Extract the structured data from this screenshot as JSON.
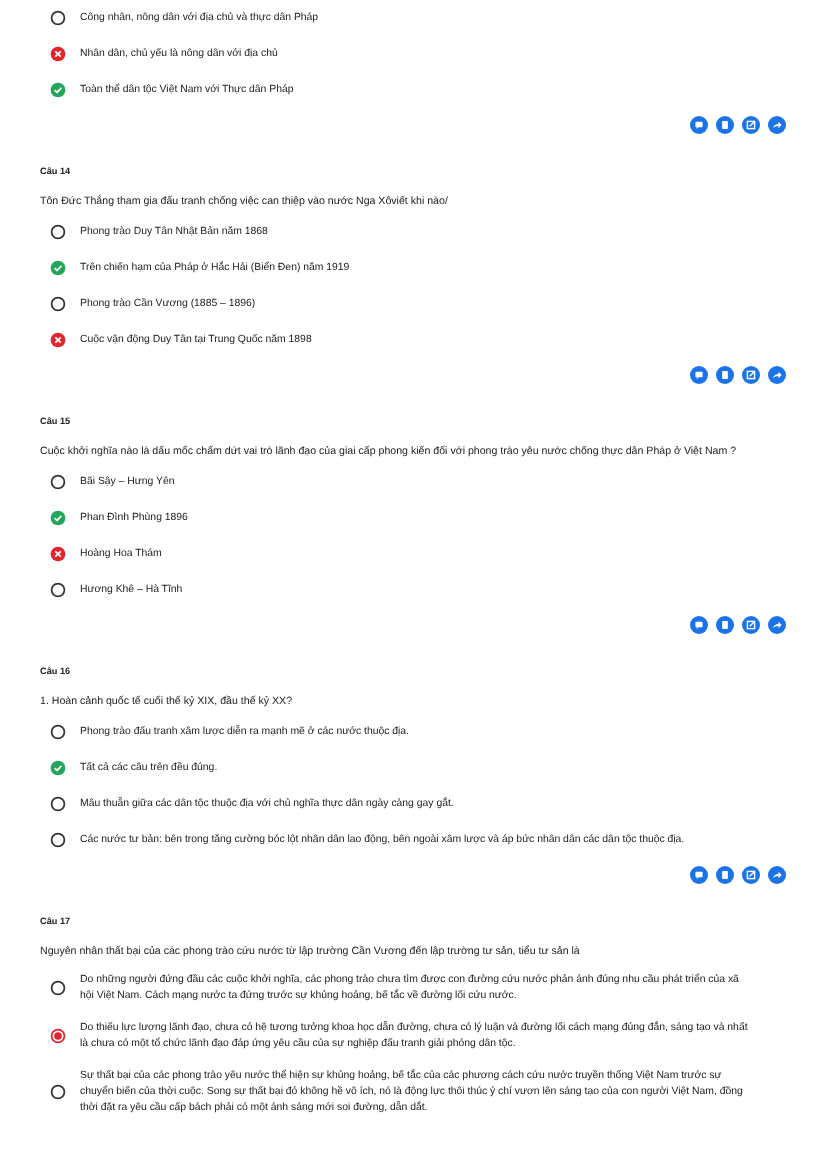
{
  "questions": [
    {
      "actions": true,
      "options": [
        {
          "text": "Công nhân, nông dân với địa chủ và thực dân Pháp",
          "kind": "empty"
        },
        {
          "text": "Nhân dân, chủ yếu là nông dân với địa chủ",
          "kind": "wrong"
        },
        {
          "text": "Toàn thể dân tộc Việt Nam với Thực dân Pháp",
          "kind": "correct"
        }
      ]
    },
    {
      "actions": true,
      "label": "Câu 14",
      "question": "Tôn Đức Thắng tham gia đấu tranh chống việc can thiệp vào nước Nga Xôviết khi nào/",
      "options": [
        {
          "text": "Phong trào Duy Tân Nhật Bản năm 1868",
          "kind": "empty"
        },
        {
          "text": "Trên chiến hạm của Pháp ở Hắc Hải (Biển Đen) năm 1919",
          "kind": "correct"
        },
        {
          "text": "Phong trào Cần Vương (1885 – 1896)",
          "kind": "empty"
        },
        {
          "text": "Cuộc vận động Duy Tân tại Trung Quốc năm 1898",
          "kind": "wrong"
        }
      ]
    },
    {
      "actions": true,
      "label": "Câu 15",
      "question": "Cuộc khởi nghĩa nào là dấu mốc chấm dứt vai trò lãnh đạo của giai cấp phong kiến đối với phong trào yêu nước chống thực dân Pháp ở Việt Nam ?",
      "options": [
        {
          "text": "Bãi Sậy – Hưng Yên",
          "kind": "empty"
        },
        {
          "text": "Phan Đình Phùng 1896",
          "kind": "correct"
        },
        {
          "text": "Hoàng Hoa Thám",
          "kind": "wrong"
        },
        {
          "text": "Hương Khê – Hà Tĩnh",
          "kind": "empty"
        }
      ]
    },
    {
      "actions": true,
      "label": "Câu 16",
      "question": "1. Hoàn cảnh quốc tế cuối thế kỷ XIX, đầu thế kỷ XX?",
      "options": [
        {
          "text": "Phong trào đấu tranh xâm lược diễn ra mạnh mẽ ở các nước thuộc địa.",
          "kind": "empty"
        },
        {
          "text": "Tất cả các câu trên đều đúng.",
          "kind": "correct"
        },
        {
          "text": "Mâu thuẫn giữa các dân tộc thuộc địa với chủ nghĩa thực dân ngày càng gay gắt.",
          "kind": "empty"
        },
        {
          "text": "Các nước tư bản: bên trong tăng cường bóc lột nhân dân lao động, bên ngoài xâm lược và áp bức nhân dân các dân tộc thuộc địa.",
          "kind": "empty"
        }
      ]
    },
    {
      "label": "Câu 17",
      "question": "Nguyên nhân thất bại của các phong trào cứu nước từ lập trường Cần Vương đến lập trường tư sản, tiểu tư sản là",
      "options": [
        {
          "text": "Do những người đứng đầu các cuộc khởi nghĩa, các phong trào chưa tìm được con đường cứu nước phản ánh đúng nhu cầu phát triển của xã hội Việt Nam. Cách mạng nước ta đứng trước sự khủng hoảng, bế tắc về đường lối cứu nước.",
          "kind": "empty"
        },
        {
          "text": "Do thiếu lực lượng lãnh đạo, chưa có hệ tương tưởng khoa học dẫn đường, chưa có lý luận và đường lối cách mạng đúng đắn, sáng tạo và nhất là chưa có một tổ chức lãnh đạo đáp ứng yêu cầu của sự nghiệp đấu tranh giải phóng dân tộc.",
          "kind": "chosen"
        },
        {
          "text": "Sự thất bại của các phong trào yêu nước thể hiện sự khủng hoảng, bế tắc của các phương cách cứu nước truyền thống Việt Nam trước sự chuyển biến của thời cuộc. Song sự thất bại đó không hề vô ích, nó là động lực thôi thúc ý chí vươn lên sáng tạo của con người Việt Nam, đồng thời đặt ra yêu cầu cấp bách phải có một ánh sáng mới soi đường, dẫn dắt.",
          "kind": "empty"
        }
      ],
      "actions": false
    }
  ]
}
